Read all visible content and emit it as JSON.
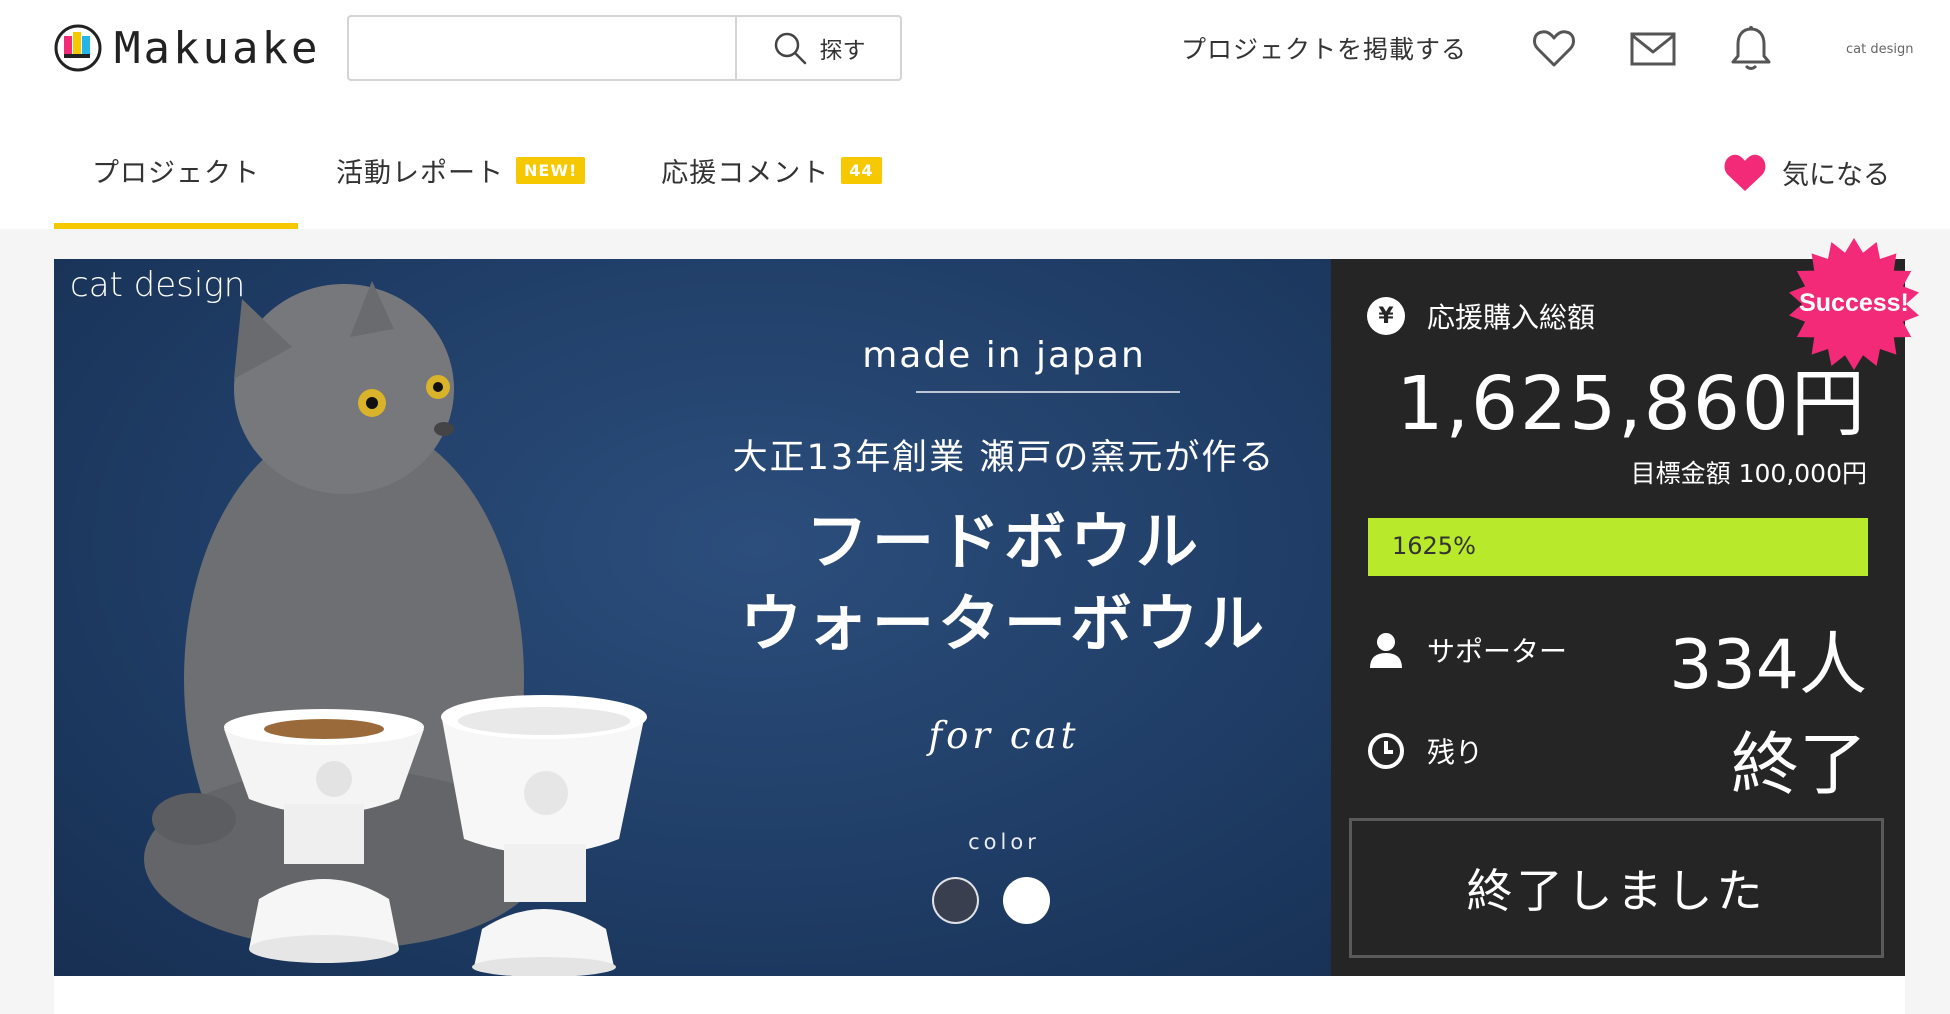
{
  "header": {
    "logo_text": "Makuake",
    "search_placeholder": "",
    "search_button": "探す",
    "post_project": "プロジェクトを掲載する",
    "user_name": "cat design"
  },
  "tabs": [
    {
      "label": "プロジェクト",
      "badge": ""
    },
    {
      "label": "活動レポート",
      "badge": "NEW!"
    },
    {
      "label": "応援コメント",
      "badge": "44"
    }
  ],
  "favorite_label": "気になる",
  "hero": {
    "brand_tag": "cat design",
    "made_in": "made in japan",
    "sub_copy": "大正13年創業 瀬戸の窯元が作る",
    "title_line1": "フードボウル",
    "title_line2": "ウォーターボウル",
    "for_cat": "for cat",
    "color_label": "color",
    "colors": [
      "#3a3f4f",
      "#ffffff"
    ]
  },
  "stats": {
    "total_label": "応援購入総額",
    "total_value": "1,625,860円",
    "goal_text": "目標金額 100,000円",
    "progress_text": "1625%",
    "progress_fill_fraction": 1.0,
    "supporters_label": "サポーター",
    "supporters_value": "334人",
    "remaining_label": "残り",
    "remaining_value": "終了",
    "ended_button": "終了しました",
    "success_badge": "Success!"
  },
  "colors": {
    "accent_yellow": "#f6c800",
    "favorite_pink": "#f22a78",
    "progress_green": "#b8e92a",
    "panel_bg": "#252525",
    "hero_blue": "#1f3d66"
  }
}
